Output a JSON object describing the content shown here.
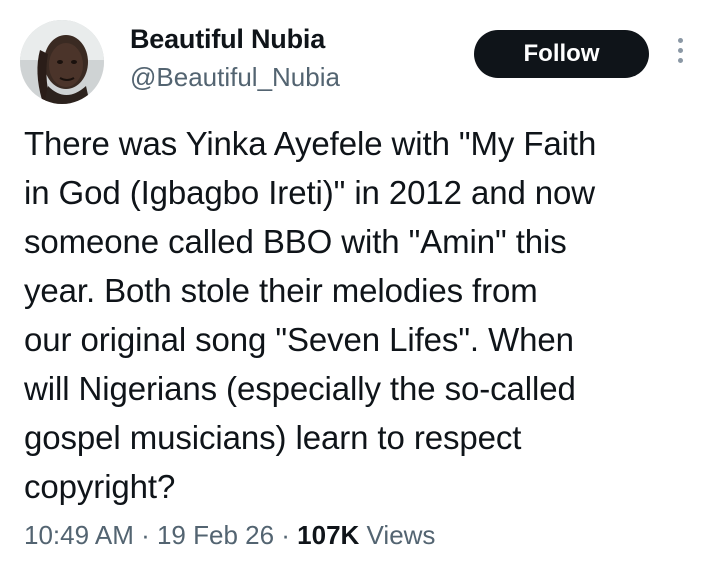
{
  "author": {
    "display_name": "Beautiful Nubia",
    "handle": "@Beautiful_Nubia",
    "avatar_icon": "person-photo-icon"
  },
  "actions": {
    "follow_label": "Follow",
    "more_icon": "vertical-dots-icon"
  },
  "tweet": {
    "lines": [
      "There was Yinka Ayefele with \"My Faith",
      "in God (Igbagbo Ireti)\" in 2012 and now",
      "someone called BBO with \"Amin\" this",
      "year. Both stole their melodies from",
      "our original song \"Seven Lifes\". When",
      "will Nigerians (especially the so-called",
      "gospel musicians) learn to respect",
      "copyright?"
    ]
  },
  "meta": {
    "time": "10:49 AM",
    "sep1": " · ",
    "date": "19 Feb 26",
    "sep2": " · ",
    "views_count": "107K",
    "views_label": " Views"
  },
  "colors": {
    "text_primary": "#0f1419",
    "text_secondary": "#536471",
    "button_bg": "#0f1419",
    "button_text": "#ffffff",
    "background": "#ffffff"
  }
}
